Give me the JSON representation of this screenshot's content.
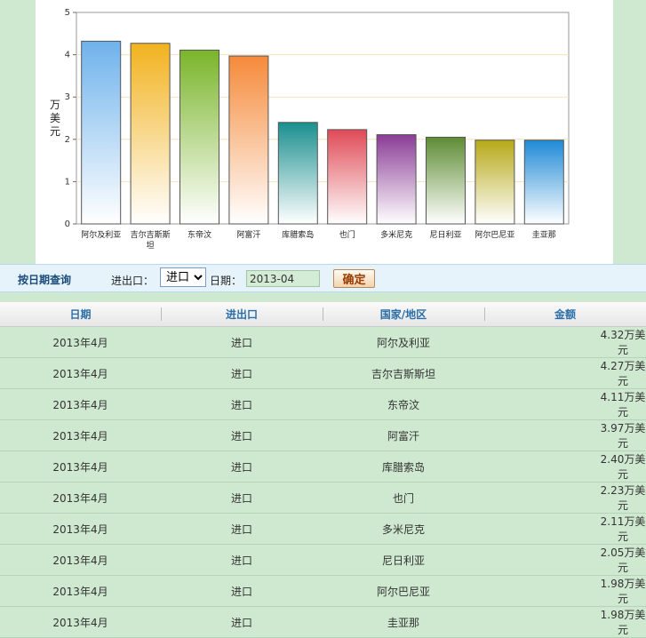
{
  "chart_data": {
    "type": "bar",
    "ylabel": "万美元",
    "ylim": [
      0,
      5
    ],
    "yticks": [
      "0",
      "1",
      "2",
      "3",
      "4",
      "5"
    ],
    "grid": true,
    "categories": [
      "阿尔及利亚",
      "吉尔吉斯斯坦",
      "东帝汶",
      "阿富汗",
      "库腊索岛",
      "也门",
      "多米尼克",
      "尼日利亚",
      "阿尔巴尼亚",
      "圭亚那"
    ],
    "values": [
      4.32,
      4.27,
      4.11,
      3.97,
      2.4,
      2.23,
      2.11,
      2.05,
      1.98,
      1.98
    ],
    "colors": [
      "#6fb2ec",
      "#f2b21e",
      "#7ab52a",
      "#f58a3a",
      "#1b8f8f",
      "#e04a56",
      "#8a3d96",
      "#5e8c34",
      "#b6a918",
      "#1f8ad6"
    ]
  },
  "query": {
    "title": "按日期查询",
    "direction_label": "进出口：",
    "direction_value": "进口",
    "date_label": "日期：",
    "date_value": "2013-04",
    "confirm_label": "确定"
  },
  "table": {
    "headers": [
      "日期",
      "进出口",
      "国家/地区",
      "金额"
    ],
    "rows": [
      [
        "2013年4月",
        "进口",
        "阿尔及利亚",
        "4.32万美元"
      ],
      [
        "2013年4月",
        "进口",
        "吉尔吉斯斯坦",
        "4.27万美元"
      ],
      [
        "2013年4月",
        "进口",
        "东帝汶",
        "4.11万美元"
      ],
      [
        "2013年4月",
        "进口",
        "阿富汗",
        "3.97万美元"
      ],
      [
        "2013年4月",
        "进口",
        "库腊索岛",
        "2.40万美元"
      ],
      [
        "2013年4月",
        "进口",
        "也门",
        "2.23万美元"
      ],
      [
        "2013年4月",
        "进口",
        "多米尼克",
        "2.11万美元"
      ],
      [
        "2013年4月",
        "进口",
        "尼日利亚",
        "2.05万美元"
      ],
      [
        "2013年4月",
        "进口",
        "阿尔巴尼亚",
        "1.98万美元"
      ],
      [
        "2013年4月",
        "进口",
        "圭亚那",
        "1.98万美元"
      ]
    ]
  }
}
